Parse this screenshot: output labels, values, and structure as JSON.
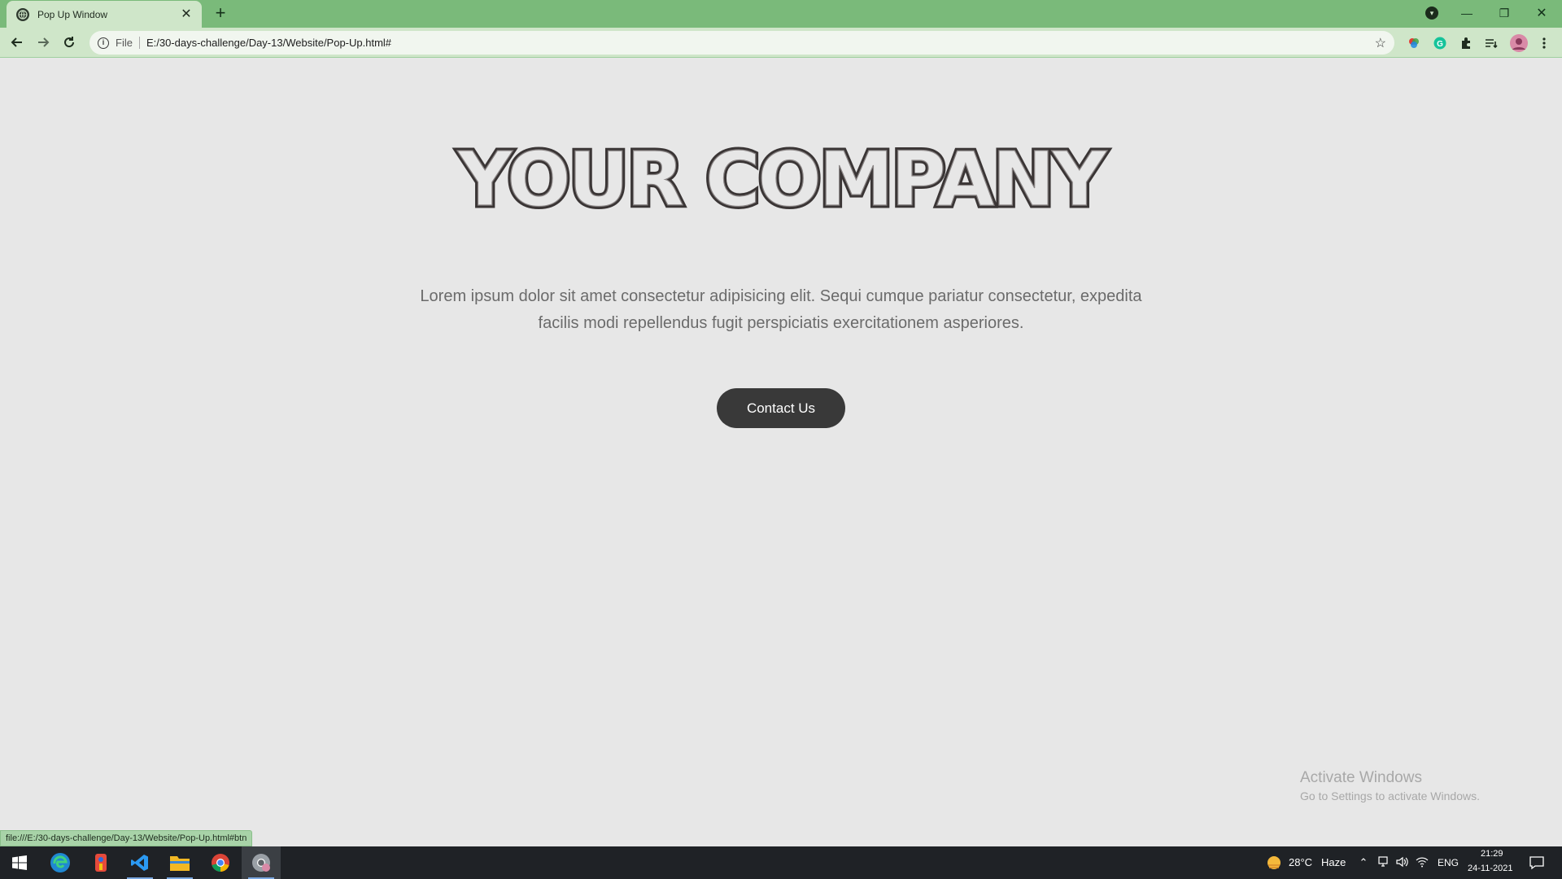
{
  "browser": {
    "tab_title": "Pop Up Window",
    "tab_close": "✕",
    "new_tab": "+",
    "scheme_label": "File",
    "url": "E:/30-days-challenge/Day-13/Website/Pop-Up.html#",
    "window_controls": {
      "minimize": "—",
      "restore": "❐",
      "close": "✕"
    },
    "accent": "#7aba7a"
  },
  "page": {
    "heading": "YOUR COMPANY",
    "paragraph": "Lorem ipsum dolor sit amet consectetur adipisicing elit. Sequi cumque pariatur consectetur, expedita facilis modi repellendus fugit perspiciatis exercitationem asperiores.",
    "button_label": "Contact Us"
  },
  "watermark": {
    "line1": "Activate Windows",
    "line2": "Go to Settings to activate Windows."
  },
  "status_url": "file:///E:/30-days-challenge/Day-13/Website/Pop-Up.html#btn",
  "taskbar": {
    "weather_temp": "28°C",
    "weather_desc": "Haze",
    "language": "ENG",
    "time": "21:29",
    "date": "24-11-2021",
    "icons": [
      "windows-start-icon",
      "edge-icon",
      "paint-icon",
      "vscode-icon",
      "file-explorer-icon",
      "chrome-icon",
      "chrome-alt-icon"
    ]
  }
}
